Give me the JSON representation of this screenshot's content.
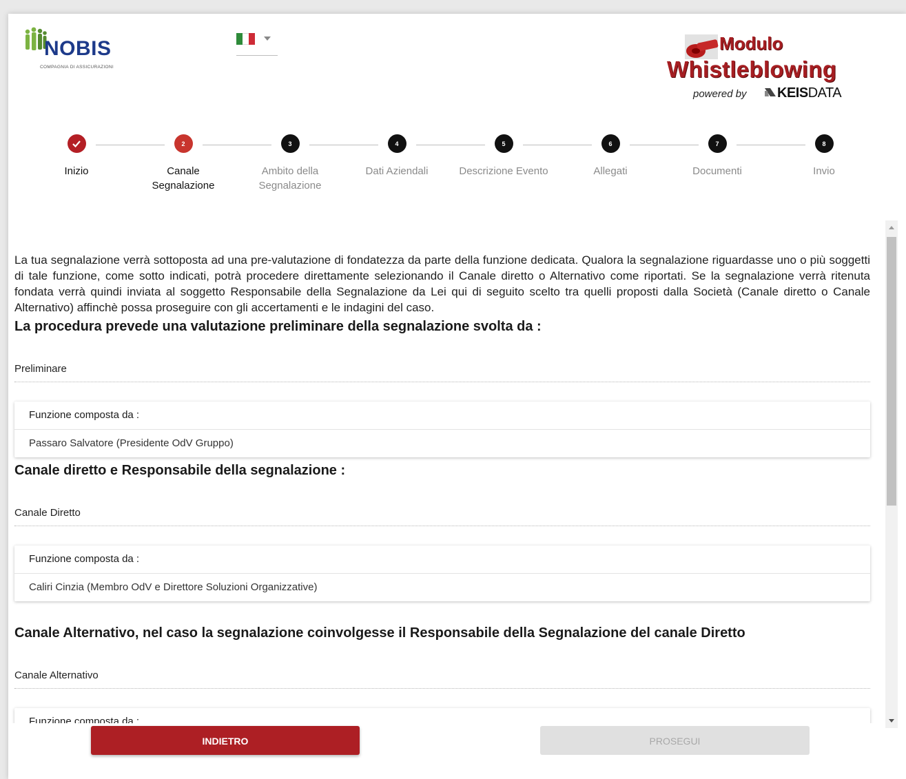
{
  "header": {
    "logo_text": "NOBIS",
    "logo_subtext": "COMPAGNIA DI ASSICURAZIONI",
    "language_flag": "italian-flag-icon",
    "brand": {
      "line1": "Modulo",
      "line2": "Whistleblowing",
      "powered_by": "powered by",
      "company_bold": "KEIS",
      "company_light": "DATA"
    }
  },
  "steps": [
    {
      "number": "✓",
      "label": "Inizio",
      "state": "done"
    },
    {
      "number": "2",
      "label": "Canale Segnalazione",
      "state": "active"
    },
    {
      "number": "3",
      "label": "Ambito della Segnalazione",
      "state": "todo"
    },
    {
      "number": "4",
      "label": "Dati Aziendali",
      "state": "todo"
    },
    {
      "number": "5",
      "label": "Descrizione Evento",
      "state": "todo"
    },
    {
      "number": "6",
      "label": "Allegati",
      "state": "todo"
    },
    {
      "number": "7",
      "label": "Documenti",
      "state": "todo"
    },
    {
      "number": "8",
      "label": "Invio",
      "state": "todo"
    }
  ],
  "content": {
    "intro": "La tua segnalazione verrà sottoposta ad una pre-valutazione di fondatezza da parte della funzione dedicata. Qualora la segnalazione riguardasse uno o più soggetti di tale funzione, come sotto indicati, potrà procedere direttamente selezionando il Canale diretto o Alternativo come riportati. Se la segnalazione verrà ritenuta fondata verrà quindi inviata al soggetto Responsabile della Segnalazione da Lei qui di seguito scelto tra quelli proposti dalla Società (Canale diretto o Canale Alternativo) affinchè possa proseguire con gli accertamenti e le indagini del caso.",
    "section1": {
      "title": "La procedura prevede una valutazione preliminare della segnalazione svolta da :",
      "field": "Preliminare",
      "card_head": "Funzione composta da :",
      "card_body": "Passaro Salvatore (Presidente OdV Gruppo)"
    },
    "section2": {
      "title": "Canale diretto e Responsabile della segnalazione :",
      "field": "Canale Diretto",
      "card_head": "Funzione composta da :",
      "card_body": "Caliri Cinzia (Membro OdV e Direttore Soluzioni Organizzative)"
    },
    "section3": {
      "title": "Canale Alternativo, nel caso la segnalazione coinvolgesse il Responsabile della Segnalazione del canale Diretto",
      "field": "Canale Alternativo",
      "card_head": "Funzione composta da :"
    }
  },
  "buttons": {
    "back": "INDIETRO",
    "next": "PROSEGUI"
  },
  "colors": {
    "accent": "#ad1f24",
    "step_todo": "#111111",
    "disabled_button": "#e0e0e0"
  }
}
